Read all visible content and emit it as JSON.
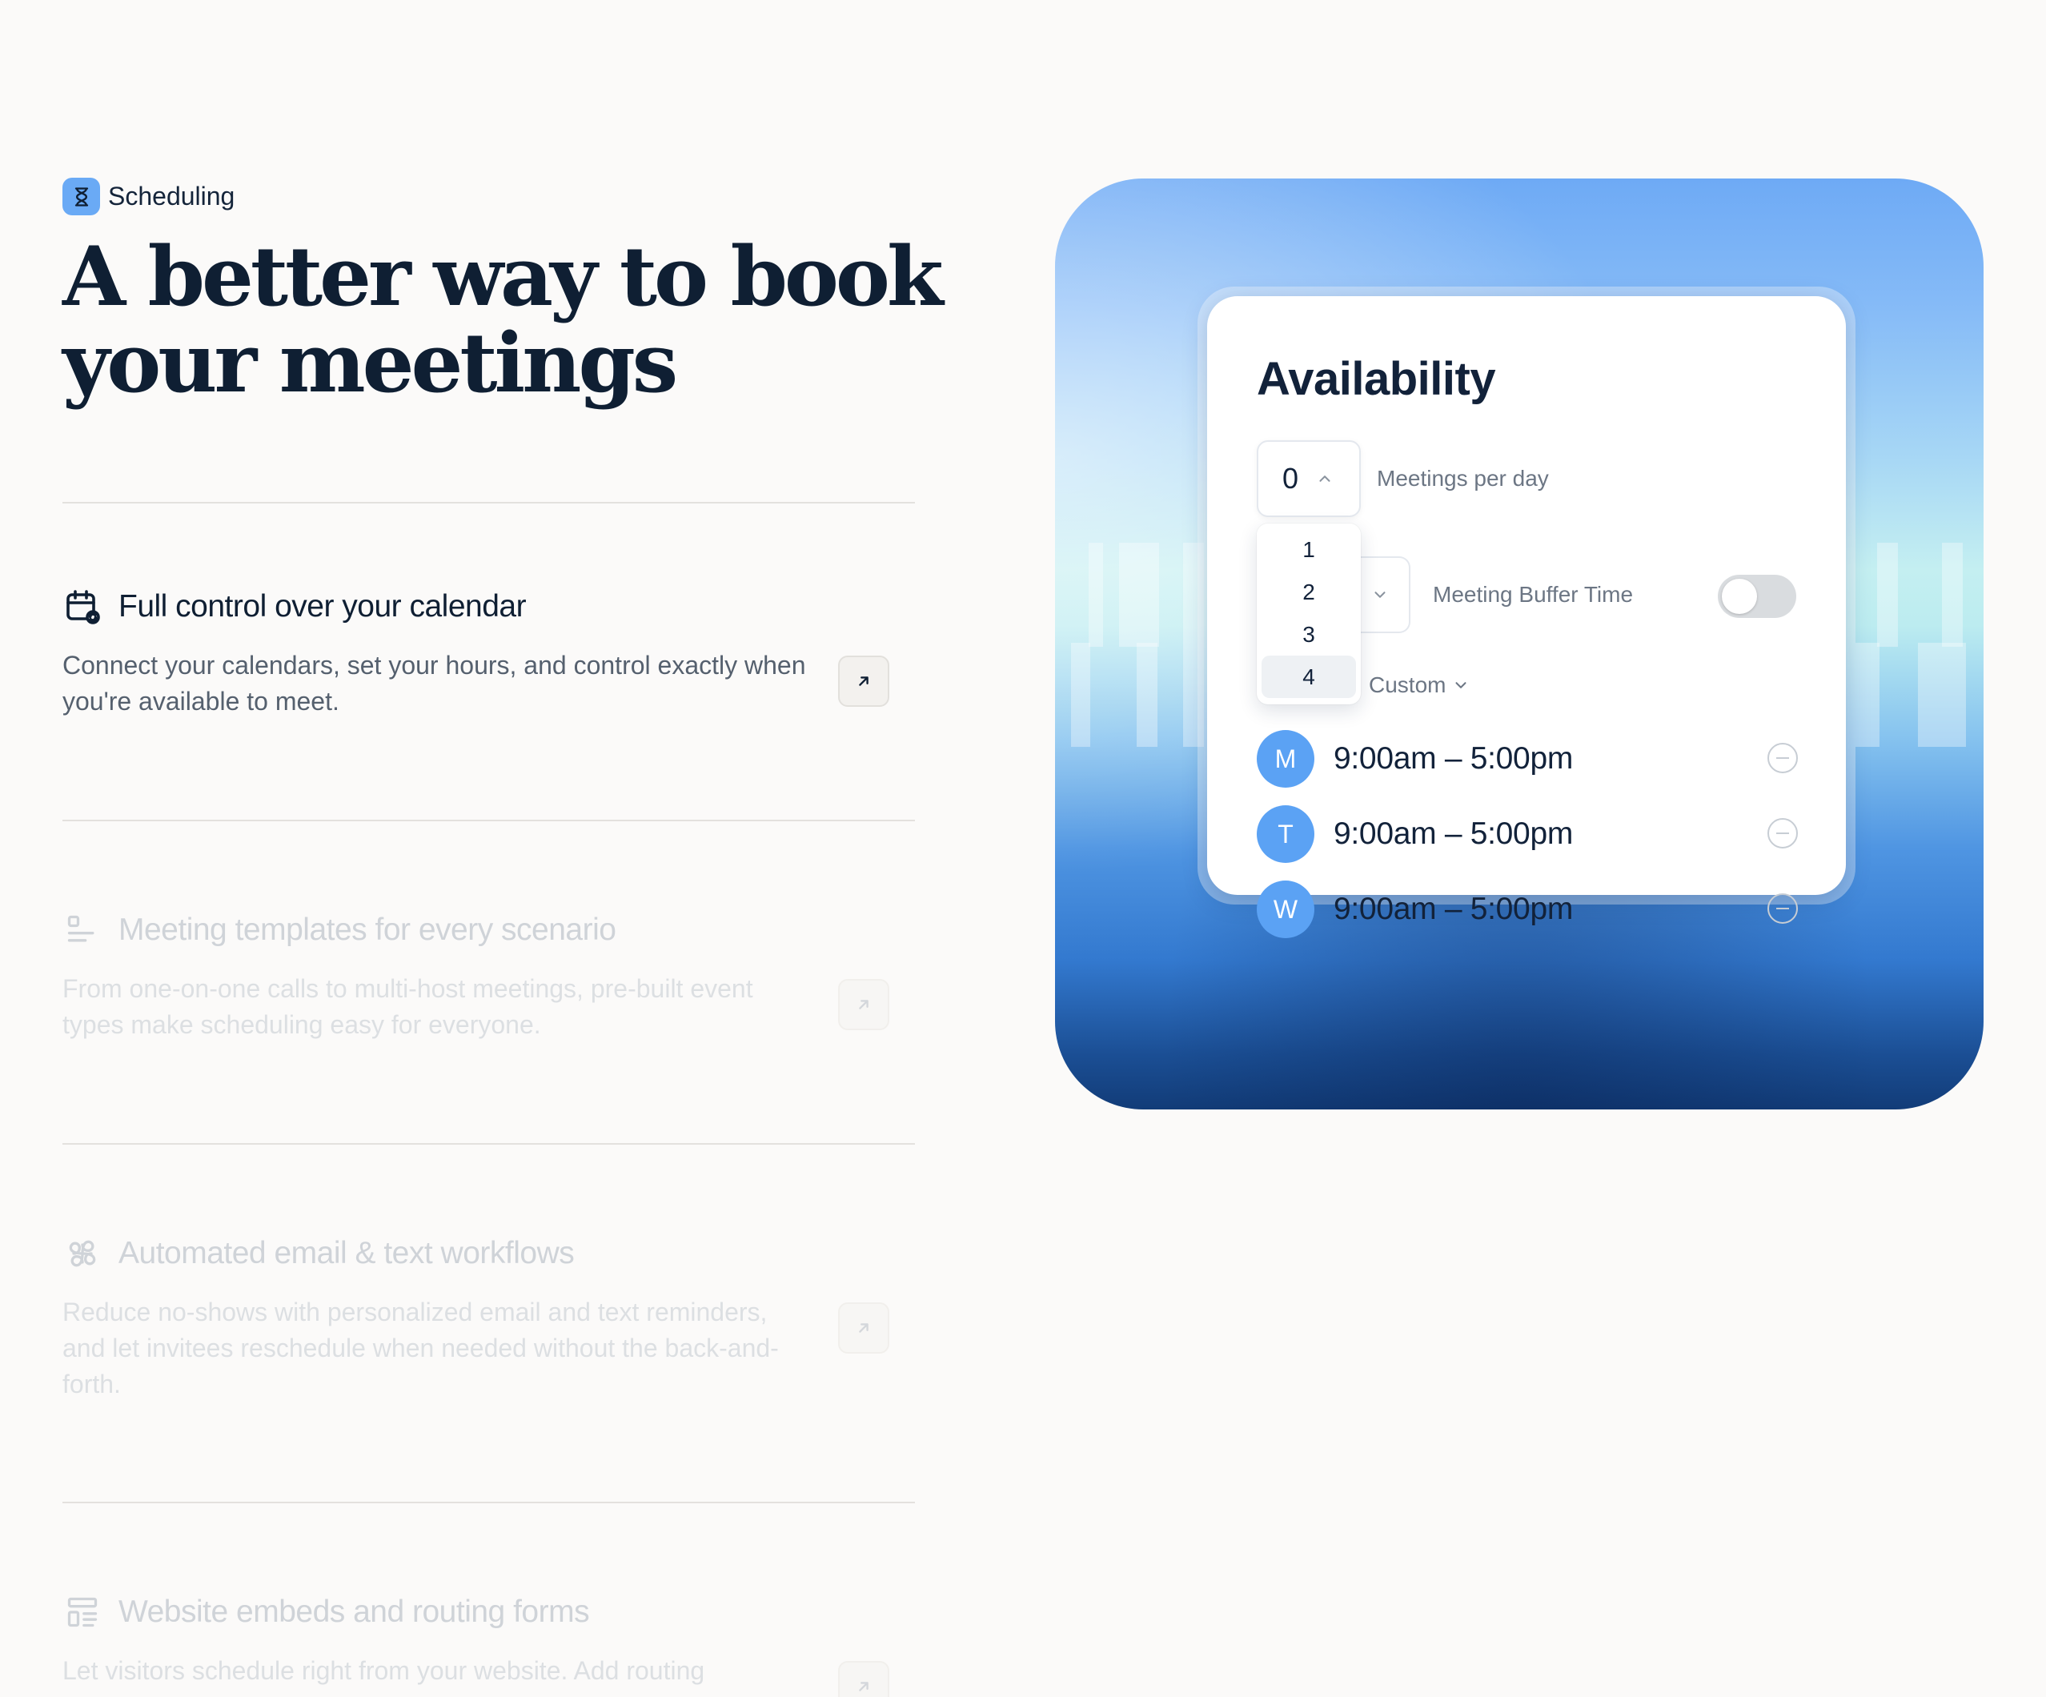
{
  "eyebrow": {
    "label": "Scheduling",
    "icon": "hourglass-icon"
  },
  "headline": "A better way to book your meetings",
  "features": [
    {
      "title": "Full control over your calendar",
      "description": "Connect your calendars, set your hours, and control exactly when you're available to meet.",
      "icon": "calendar-sync-icon",
      "state": "active"
    },
    {
      "title": "Meeting templates for every scenario",
      "description": "From one-on-one calls to multi-host meetings, pre-built event types make scheduling easy for everyone.",
      "icon": "template-icon",
      "state": "muted"
    },
    {
      "title": "Automated email & text workflows",
      "description": "Reduce no-shows with personalized email and text reminders, and let invitees reschedule when needed without the back-and-forth.",
      "icon": "workflow-icon",
      "state": "muted"
    },
    {
      "title": "Website embeds and routing forms",
      "description": "Let visitors schedule right from your website. Add routing",
      "icon": "form-icon",
      "state": "muted"
    }
  ],
  "availability": {
    "title": "Availability",
    "counter_value": "0",
    "meetings_label": "Meetings per day",
    "dropdown_options": [
      "1",
      "2",
      "3",
      "4"
    ],
    "dropdown_selected": "4",
    "buffer_label": "Meeting Buffer Time",
    "buffer_enabled": false,
    "custom_label": "Custom",
    "days": [
      {
        "letter": "M",
        "time": "9:00am – 5:00pm"
      },
      {
        "letter": "T",
        "time": "9:00am – 5:00pm"
      },
      {
        "letter": "W",
        "time": "9:00am – 5:00pm"
      }
    ]
  },
  "colors": {
    "accent": "#5ba2f4",
    "text_primary": "#0f1f33",
    "text_muted": "#cfd3d8",
    "background": "#fbfaf9"
  }
}
